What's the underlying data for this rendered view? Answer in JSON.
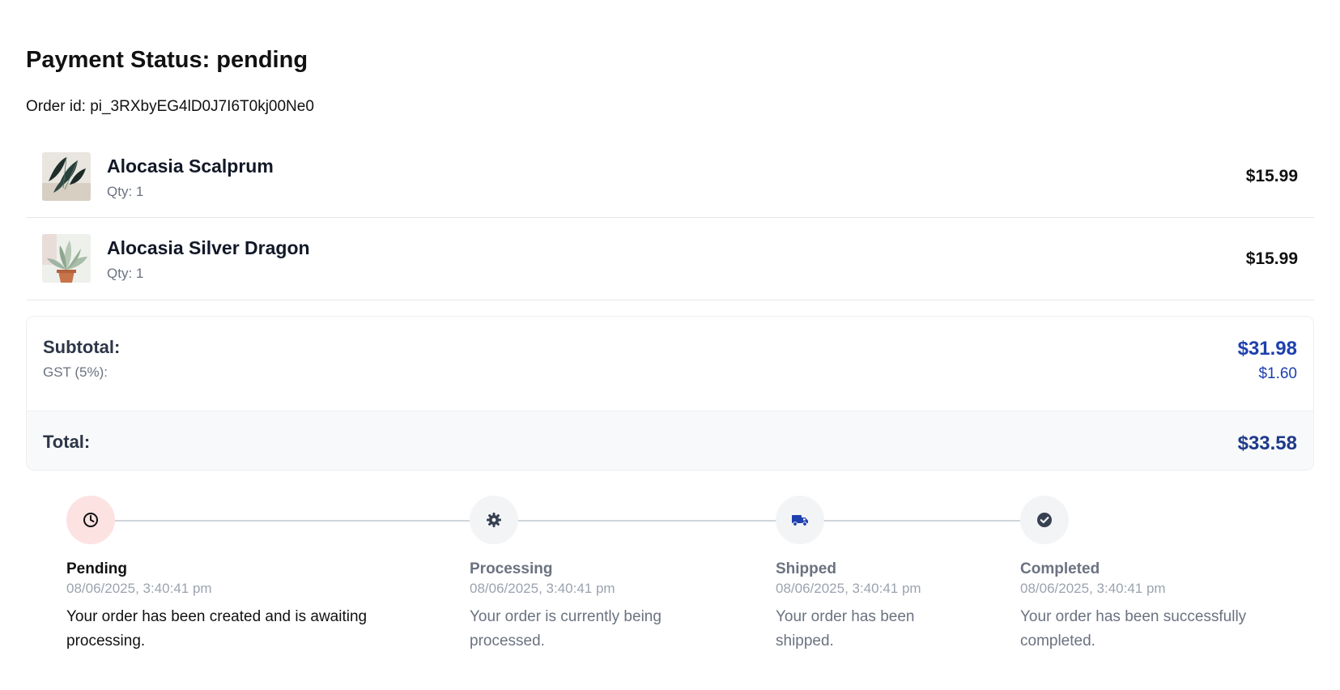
{
  "payment": {
    "status_heading": "Payment Status: pending",
    "order_id_label": "Order id: pi_3RXbyEG4lD0J7I6T0kj00Ne0"
  },
  "items": [
    {
      "name": "Alocasia Scalprum",
      "qty": "Qty: 1",
      "price": "$15.99"
    },
    {
      "name": "Alocasia Silver Dragon",
      "qty": "Qty: 1",
      "price": "$15.99"
    }
  ],
  "summary": {
    "subtotal_label": "Subtotal:",
    "subtotal_value": "$31.98",
    "gst_label": "GST (5%):",
    "gst_value": "$1.60",
    "total_label": "Total:",
    "total_value": "$33.58"
  },
  "timeline": {
    "steps": [
      {
        "title": "Pending",
        "date": "08/06/2025, 3:40:41 pm",
        "description": "Your order has been created and is awaiting processing.",
        "icon": "clock-icon",
        "active": true
      },
      {
        "title": "Processing",
        "date": "08/06/2025, 3:40:41 pm",
        "description": "Your order is currently being processed.",
        "icon": "gear-icon",
        "active": false
      },
      {
        "title": "Shipped",
        "date": "08/06/2025, 3:40:41 pm",
        "description": "Your order has been shipped.",
        "icon": "truck-icon",
        "active": false
      },
      {
        "title": "Completed",
        "date": "08/06/2025, 3:40:41 pm",
        "description": "Your order has been successfully completed.",
        "icon": "check-circle-icon",
        "active": false
      }
    ]
  },
  "colors": {
    "accent_blue": "#1e40af",
    "total_blue": "#1e3a8a",
    "pending_bg": "#fde2e2",
    "step_bg": "#f3f4f6"
  }
}
